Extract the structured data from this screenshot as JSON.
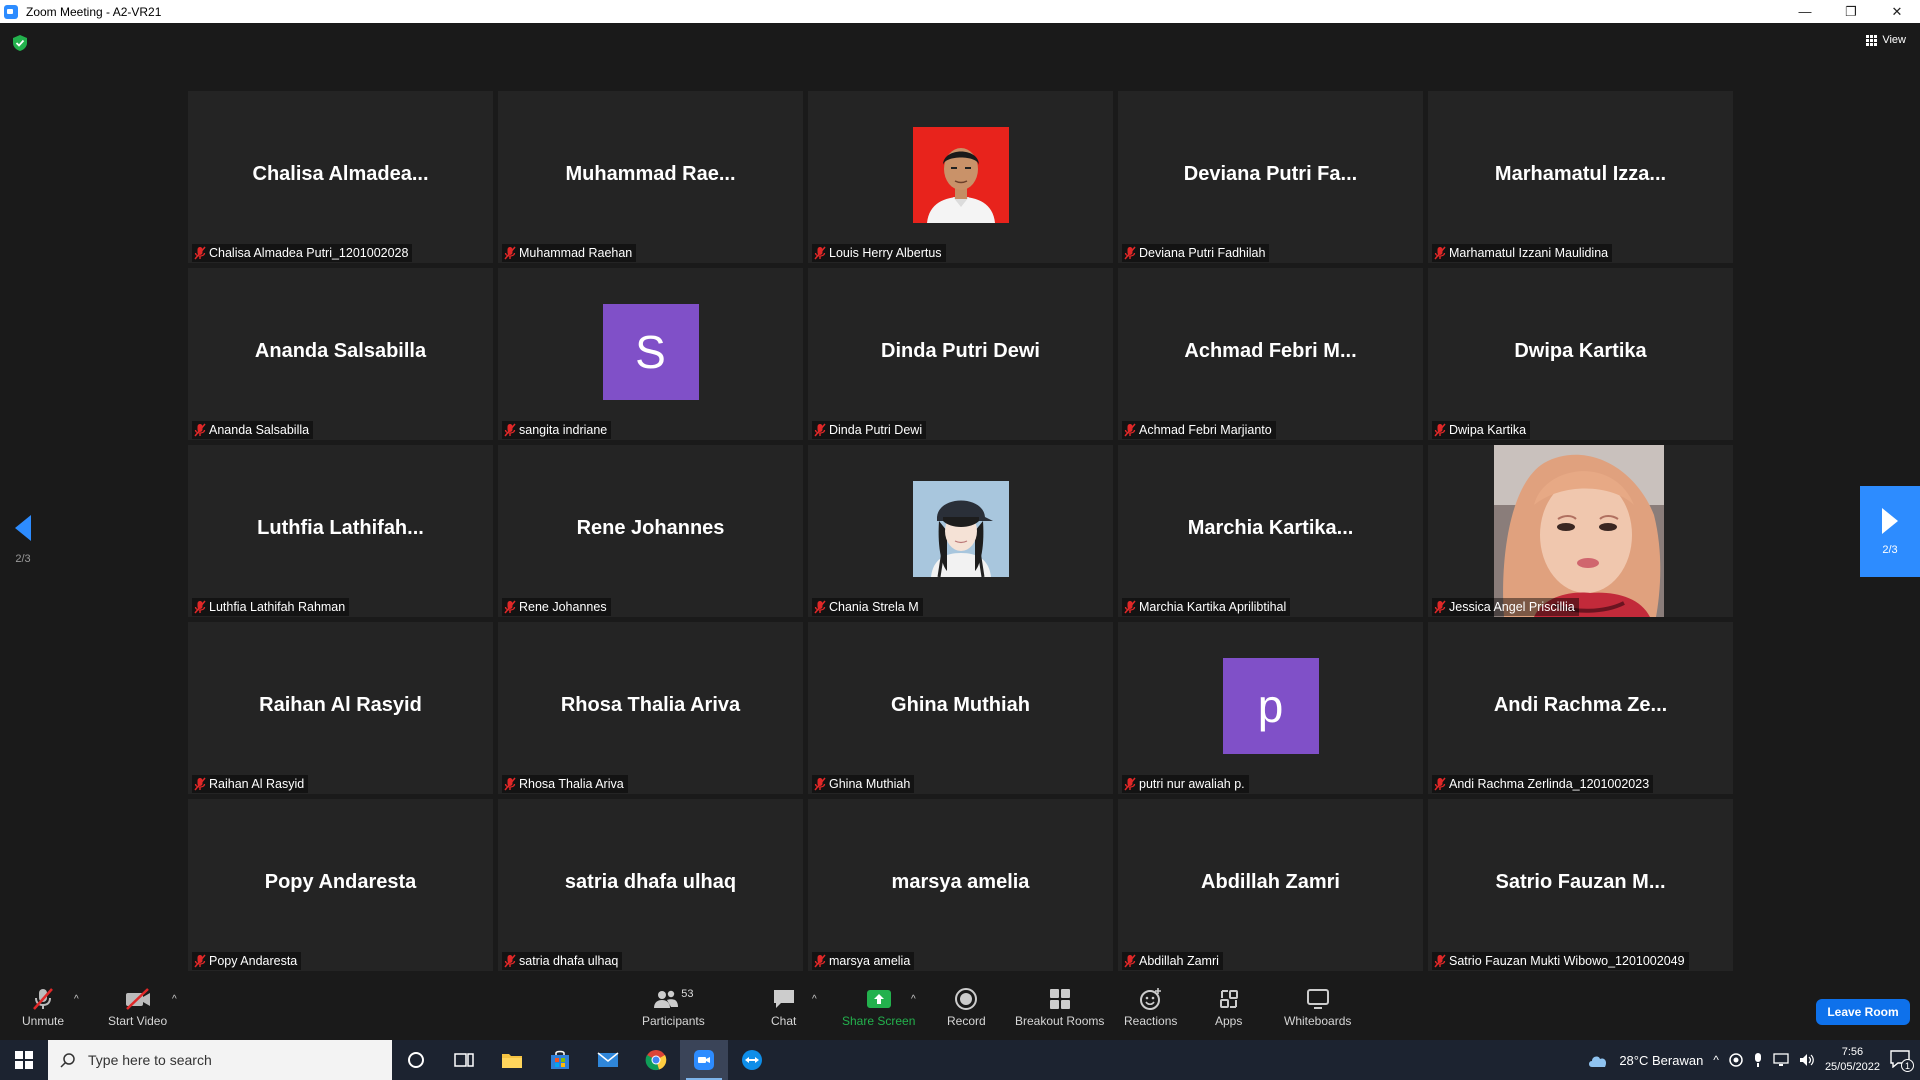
{
  "window": {
    "title": "Zoom Meeting - A2-VR21",
    "minimize": "—",
    "restore": "❐",
    "close": "✕"
  },
  "view": {
    "label": "View"
  },
  "pager": {
    "left": "2/3",
    "right": "2/3"
  },
  "participants": [
    {
      "display": "Chalisa  Almadea...",
      "label": "Chalisa Almadea Putri_1201002028",
      "avatar": "name"
    },
    {
      "display": "Muhammad  Rae...",
      "label": "Muhammad Raehan",
      "avatar": "name"
    },
    {
      "display": "",
      "label": "Louis Herry Albertus",
      "avatar": "photo-louis"
    },
    {
      "display": "Deviana  Putri  Fa...",
      "label": "Deviana Putri Fadhilah",
      "avatar": "name"
    },
    {
      "display": "Marhamatul  Izza...",
      "label": "Marhamatul Izzani Maulidina",
      "avatar": "name"
    },
    {
      "display": "Ananda Salsabilla",
      "label": "Ananda Salsabilla",
      "avatar": "name"
    },
    {
      "display": "S",
      "label": "sangita indriane",
      "avatar": "letter"
    },
    {
      "display": "Dinda Putri Dewi",
      "label": "Dinda Putri Dewi",
      "avatar": "name"
    },
    {
      "display": "Achmad  Febri  M...",
      "label": "Achmad Febri Marjianto",
      "avatar": "name"
    },
    {
      "display": "Dwipa Kartika",
      "label": "Dwipa Kartika",
      "avatar": "name"
    },
    {
      "display": "Luthfia  Lathifah...",
      "label": "Luthfia Lathifah Rahman",
      "avatar": "name"
    },
    {
      "display": "Rene Johannes",
      "label": "Rene Johannes",
      "avatar": "name"
    },
    {
      "display": "",
      "label": "Chania Strela M",
      "avatar": "photo-chania"
    },
    {
      "display": "Marchia  Kartika...",
      "label": "Marchia Kartika Aprilibtihal",
      "avatar": "name"
    },
    {
      "display": "",
      "label": "Jessica Angel Priscillia",
      "avatar": "photo-jessica"
    },
    {
      "display": "Raihan Al Rasyid",
      "label": "Raihan Al Rasyid",
      "avatar": "name"
    },
    {
      "display": "Rhosa Thalia Ariva",
      "label": "Rhosa Thalia Ariva",
      "avatar": "name"
    },
    {
      "display": "Ghina Muthiah",
      "label": "Ghina Muthiah",
      "avatar": "name"
    },
    {
      "display": "p",
      "label": "putri nur awaliah p.",
      "avatar": "letter"
    },
    {
      "display": "Andi  Rachma  Ze...",
      "label": "Andi Rachma Zerlinda_1201002023",
      "avatar": "name"
    },
    {
      "display": "Popy Andaresta",
      "label": "Popy Andaresta",
      "avatar": "name"
    },
    {
      "display": "satria dhafa ulhaq",
      "label": "satria dhafa ulhaq",
      "avatar": "name"
    },
    {
      "display": "marsya amelia",
      "label": "marsya amelia",
      "avatar": "name"
    },
    {
      "display": "Abdillah Zamri",
      "label": "Abdillah Zamri",
      "avatar": "name"
    },
    {
      "display": "Satrio  Fauzan  M...",
      "label": "Satrio Fauzan Mukti Wibowo_1201002049",
      "avatar": "name"
    }
  ],
  "toolbar": {
    "unmute": "Unmute",
    "start_video": "Start Video",
    "participants": "Participants",
    "participants_count": "53",
    "chat": "Chat",
    "share_screen": "Share Screen",
    "record": "Record",
    "breakout_rooms": "Breakout Rooms",
    "reactions": "Reactions",
    "apps": "Apps",
    "whiteboards": "Whiteboards",
    "leave_room": "Leave Room"
  },
  "taskbar": {
    "search_placeholder": "Type here to search",
    "weather": "28°C  Berawan",
    "time": "7:56",
    "date": "25/05/2022",
    "notification_count": "1"
  },
  "colors": {
    "accent": "#2d8cff",
    "leave": "#0e71eb",
    "mic_off": "#e02828",
    "avatar_purple": "#8050c8",
    "share_green": "#23b14d"
  }
}
